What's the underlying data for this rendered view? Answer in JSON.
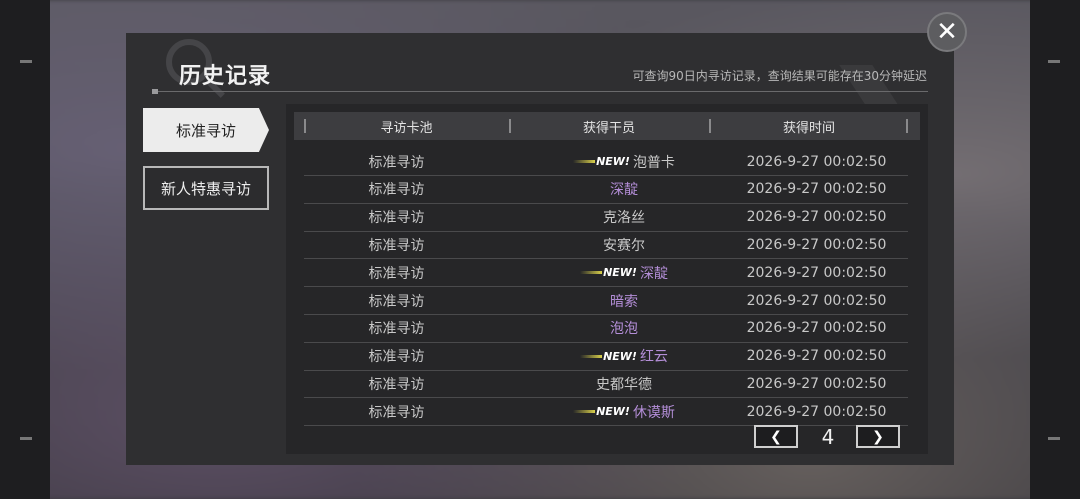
{
  "dialog": {
    "title": "历史记录",
    "subtitle": "可查询90日内寻访记录，查询结果可能存在30分钟延迟",
    "close_icon": "close-icon"
  },
  "tabs": [
    {
      "label": "标准寻访",
      "active": true
    },
    {
      "label": "新人特惠寻访",
      "active": false
    }
  ],
  "table": {
    "headers": [
      "寻访卡池",
      "获得干员",
      "获得时间"
    ],
    "new_label": "NEW!",
    "rows": [
      {
        "pool": "标准寻访",
        "operator": "泡普卡",
        "new": true,
        "rarity_color": "#c8c8c8",
        "time": "2026-9-27 00:02:50"
      },
      {
        "pool": "标准寻访",
        "operator": "深靛",
        "new": false,
        "rarity_color": "#b48ed8",
        "time": "2026-9-27 00:02:50"
      },
      {
        "pool": "标准寻访",
        "operator": "克洛丝",
        "new": false,
        "rarity_color": "#c8c8c8",
        "time": "2026-9-27 00:02:50"
      },
      {
        "pool": "标准寻访",
        "operator": "安赛尔",
        "new": false,
        "rarity_color": "#c8c8c8",
        "time": "2026-9-27 00:02:50"
      },
      {
        "pool": "标准寻访",
        "operator": "深靛",
        "new": true,
        "rarity_color": "#b48ed8",
        "time": "2026-9-27 00:02:50"
      },
      {
        "pool": "标准寻访",
        "operator": "暗索",
        "new": false,
        "rarity_color": "#b48ed8",
        "time": "2026-9-27 00:02:50"
      },
      {
        "pool": "标准寻访",
        "operator": "泡泡",
        "new": false,
        "rarity_color": "#b48ed8",
        "time": "2026-9-27 00:02:50"
      },
      {
        "pool": "标准寻访",
        "operator": "红云",
        "new": true,
        "rarity_color": "#b48ed8",
        "time": "2026-9-27 00:02:50"
      },
      {
        "pool": "标准寻访",
        "operator": "史都华德",
        "new": false,
        "rarity_color": "#c8c8c8",
        "time": "2026-9-27 00:02:50"
      },
      {
        "pool": "标准寻访",
        "operator": "休谟斯",
        "new": true,
        "rarity_color": "#b48ed8",
        "time": "2026-9-27 00:02:50"
      }
    ]
  },
  "pagination": {
    "current_page": "4",
    "prev_icon": "chevron-left-icon",
    "next_icon": "chevron-right-icon"
  }
}
